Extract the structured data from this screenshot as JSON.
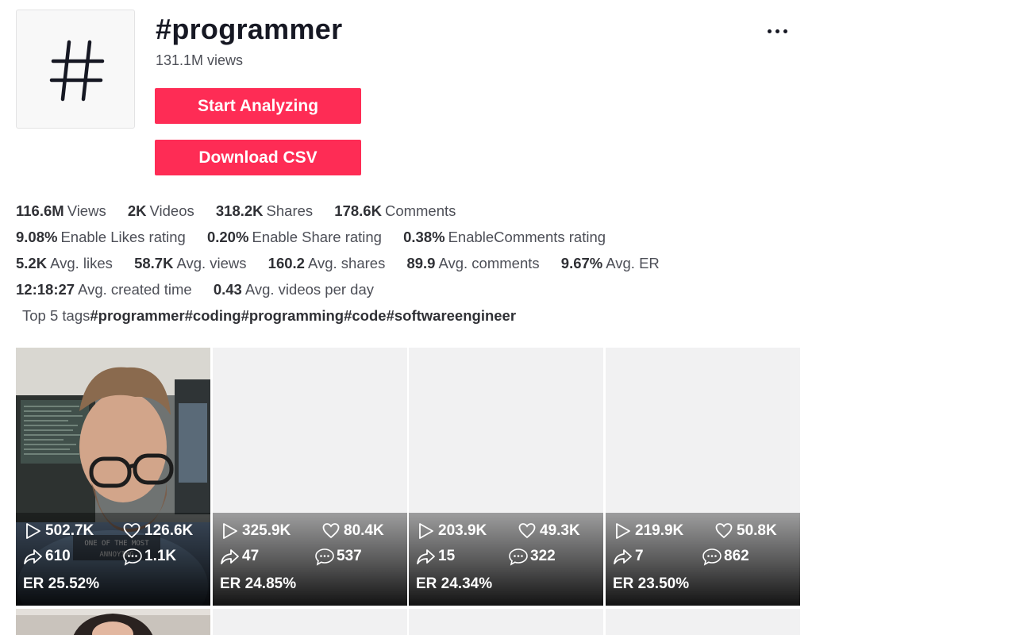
{
  "header": {
    "title": "#programmer",
    "views": "131.1M views",
    "avatar_symbol": "#",
    "more_icon": "more-horizontal-icon"
  },
  "actions": {
    "analyze_label": "Start Analyzing",
    "csv_label": "Download CSV",
    "accent_color": "#fe2c55"
  },
  "stats": {
    "row1": [
      {
        "value": "116.6M",
        "label": "Views"
      },
      {
        "value": "2K",
        "label": "Videos"
      },
      {
        "value": "318.2K",
        "label": "Shares"
      },
      {
        "value": "178.6K",
        "label": "Comments"
      }
    ],
    "row2": [
      {
        "value": "9.08%",
        "label": "Enable Likes rating"
      },
      {
        "value": "0.20%",
        "label": "Enable Share rating"
      },
      {
        "value": "0.38%",
        "label": "EnableComments rating"
      }
    ],
    "row3": [
      {
        "value": "5.2K",
        "label": "Avg. likes"
      },
      {
        "value": "58.7K",
        "label": "Avg. views"
      },
      {
        "value": "160.2",
        "label": "Avg. shares"
      },
      {
        "value": "89.9",
        "label": "Avg. comments"
      },
      {
        "value": "9.67%",
        "label": "Avg. ER"
      }
    ],
    "row4": [
      {
        "value": "12:18:27",
        "label": "Avg. created time"
      },
      {
        "value": "0.43",
        "label": "Avg. videos per day"
      }
    ],
    "tags_label": "Top 5 tags",
    "tags": [
      "#programmer",
      "#coding",
      "#programming",
      "#code",
      "#softwareengineer"
    ]
  },
  "videos": [
    {
      "plays": "502.7K",
      "likes": "126.6K",
      "shares": "610",
      "comments": "1.1K",
      "er": "ER 25.52%",
      "has_thumbnail": true,
      "caption": "ONE OF THE MOST ANNOYING"
    },
    {
      "plays": "325.9K",
      "likes": "80.4K",
      "shares": "47",
      "comments": "537",
      "er": "ER 24.85%",
      "has_thumbnail": false
    },
    {
      "plays": "203.9K",
      "likes": "49.3K",
      "shares": "15",
      "comments": "322",
      "er": "ER 24.34%",
      "has_thumbnail": false
    },
    {
      "plays": "219.9K",
      "likes": "50.8K",
      "shares": "7",
      "comments": "862",
      "er": "ER 23.50%",
      "has_thumbnail": false
    }
  ]
}
